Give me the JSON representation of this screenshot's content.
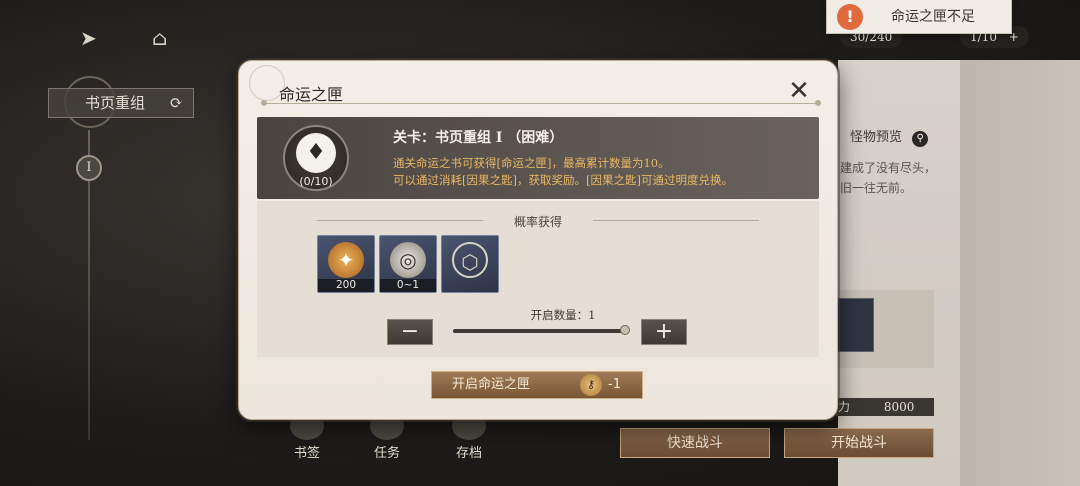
{
  "toast": {
    "icon": "!",
    "message": "命运之匣不足"
  },
  "side_panel": {
    "tag_label": "书页重组",
    "chapter_numeral": "I"
  },
  "resources": {
    "stamina": "30/240",
    "keys": "1/10",
    "plus": "+"
  },
  "bottom_nav": [
    {
      "label": "书签"
    },
    {
      "label": "任务"
    },
    {
      "label": "存档"
    }
  ],
  "background_panel": {
    "monster_preview": "怪物预览",
    "story": "建成了没有尽头，旧一往无前。",
    "power_label": "力",
    "power_value": "8000",
    "quick_battle": "快速战斗",
    "start_battle": "开始战斗"
  },
  "dialog": {
    "title": "命运之匣",
    "close": "✕",
    "stage_name": "关卡：书页重组 I （困难）",
    "box_count": "(0/10)",
    "desc_line1": "通关命运之书可获得[命运之匣]，最高累计数量为10。",
    "desc_line2": "可以通过消耗[因果之匙]，获取奖励。[因果之匙]可通过明度兑换。",
    "prob_header": "概率获得",
    "rewards": [
      {
        "qty": "200",
        "icon": "orb-icon"
      },
      {
        "qty": "0~1",
        "icon": "coin-icon"
      },
      {
        "qty": "",
        "icon": "fate-box-icon"
      }
    ],
    "open_count_label": "开启数量：1",
    "open_count": 1,
    "slider_fraction": 1.0,
    "minus": "−",
    "plus": "+",
    "open_button": "开启命运之匣",
    "open_cost": "-1"
  },
  "colors": {
    "accent_gold": "#e8b866",
    "toast_warning": "#e06a3e",
    "button_brown": "#8b6a4c"
  }
}
